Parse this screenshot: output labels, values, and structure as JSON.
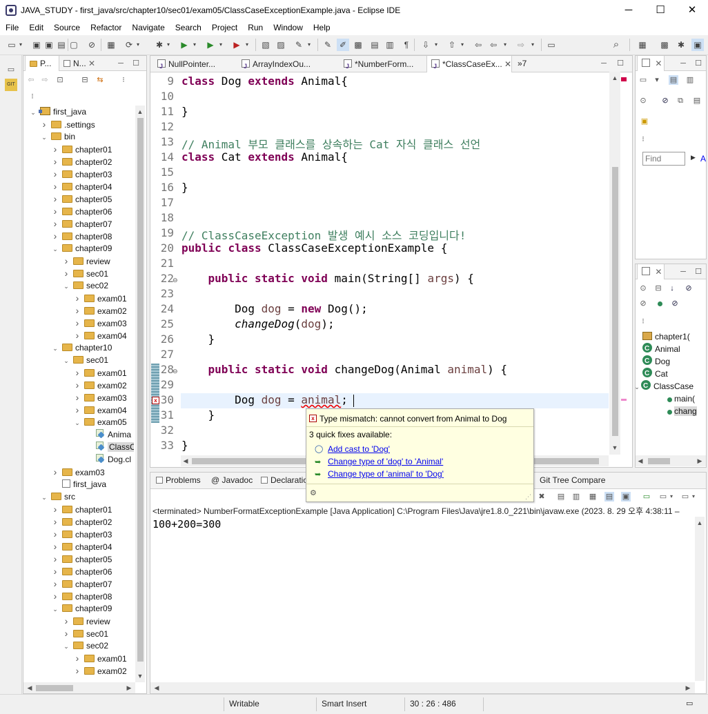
{
  "window": {
    "title": "JAVA_STUDY - first_java/src/chapter10/sec01/exam05/ClassCaseExceptionExample.java - Eclipse IDE",
    "minimize": "─",
    "maximize": "☐",
    "close": "✕"
  },
  "menu": [
    "File",
    "Edit",
    "Source",
    "Refactor",
    "Navigate",
    "Search",
    "Project",
    "Run",
    "Window",
    "Help"
  ],
  "left_panel": {
    "tabs": [
      "P...",
      "N..."
    ],
    "tree": [
      {
        "label": "first_java",
        "depth": 0,
        "twisty": "open",
        "icon": "project"
      },
      {
        "label": ".settings",
        "depth": 1,
        "twisty": "closed",
        "icon": "folder"
      },
      {
        "label": "bin",
        "depth": 1,
        "twisty": "open",
        "icon": "folder"
      },
      {
        "label": "chapter01",
        "depth": 2,
        "twisty": "closed",
        "icon": "folder"
      },
      {
        "label": "chapter02",
        "depth": 2,
        "twisty": "closed",
        "icon": "folder"
      },
      {
        "label": "chapter03",
        "depth": 2,
        "twisty": "closed",
        "icon": "folder"
      },
      {
        "label": "chapter04",
        "depth": 2,
        "twisty": "closed",
        "icon": "folder"
      },
      {
        "label": "chapter05",
        "depth": 2,
        "twisty": "closed",
        "icon": "folder"
      },
      {
        "label": "chapter06",
        "depth": 2,
        "twisty": "closed",
        "icon": "folder"
      },
      {
        "label": "chapter07",
        "depth": 2,
        "twisty": "closed",
        "icon": "folder"
      },
      {
        "label": "chapter08",
        "depth": 2,
        "twisty": "closed",
        "icon": "folder"
      },
      {
        "label": "chapter09",
        "depth": 2,
        "twisty": "open",
        "icon": "folder"
      },
      {
        "label": "review",
        "depth": 3,
        "twisty": "closed",
        "icon": "folder"
      },
      {
        "label": "sec01",
        "depth": 3,
        "twisty": "closed",
        "icon": "folder"
      },
      {
        "label": "sec02",
        "depth": 3,
        "twisty": "open",
        "icon": "folder"
      },
      {
        "label": "exam01",
        "depth": 4,
        "twisty": "closed",
        "icon": "folder"
      },
      {
        "label": "exam02",
        "depth": 4,
        "twisty": "closed",
        "icon": "folder"
      },
      {
        "label": "exam03",
        "depth": 4,
        "twisty": "closed",
        "icon": "folder"
      },
      {
        "label": "exam04",
        "depth": 4,
        "twisty": "closed",
        "icon": "folder"
      },
      {
        "label": "chapter10",
        "depth": 2,
        "twisty": "open",
        "icon": "folder"
      },
      {
        "label": "sec01",
        "depth": 3,
        "twisty": "open",
        "icon": "folder"
      },
      {
        "label": "exam01",
        "depth": 4,
        "twisty": "closed",
        "icon": "folder"
      },
      {
        "label": "exam02",
        "depth": 4,
        "twisty": "closed",
        "icon": "folder"
      },
      {
        "label": "exam03",
        "depth": 4,
        "twisty": "closed",
        "icon": "folder"
      },
      {
        "label": "exam04",
        "depth": 4,
        "twisty": "closed",
        "icon": "folder"
      },
      {
        "label": "exam05",
        "depth": 4,
        "twisty": "open",
        "icon": "folder"
      },
      {
        "label": "Anima",
        "depth": 5,
        "twisty": "none",
        "icon": "class"
      },
      {
        "label": "ClassC",
        "depth": 5,
        "twisty": "none",
        "icon": "class",
        "selected": true
      },
      {
        "label": "Dog.cl",
        "depth": 5,
        "twisty": "none",
        "icon": "class"
      },
      {
        "label": "exam03",
        "depth": 2,
        "twisty": "closed",
        "icon": "folder"
      },
      {
        "label": "first_java",
        "depth": 2,
        "twisty": "none",
        "icon": "file"
      },
      {
        "label": "src",
        "depth": 1,
        "twisty": "open",
        "icon": "folder"
      },
      {
        "label": "chapter01",
        "depth": 2,
        "twisty": "closed",
        "icon": "folder"
      },
      {
        "label": "chapter02",
        "depth": 2,
        "twisty": "closed",
        "icon": "folder"
      },
      {
        "label": "chapter03",
        "depth": 2,
        "twisty": "closed",
        "icon": "folder"
      },
      {
        "label": "chapter04",
        "depth": 2,
        "twisty": "closed",
        "icon": "folder"
      },
      {
        "label": "chapter05",
        "depth": 2,
        "twisty": "closed",
        "icon": "folder"
      },
      {
        "label": "chapter06",
        "depth": 2,
        "twisty": "closed",
        "icon": "folder"
      },
      {
        "label": "chapter07",
        "depth": 2,
        "twisty": "closed",
        "icon": "folder"
      },
      {
        "label": "chapter08",
        "depth": 2,
        "twisty": "closed",
        "icon": "folder"
      },
      {
        "label": "chapter09",
        "depth": 2,
        "twisty": "open",
        "icon": "folder"
      },
      {
        "label": "review",
        "depth": 3,
        "twisty": "closed",
        "icon": "folder"
      },
      {
        "label": "sec01",
        "depth": 3,
        "twisty": "closed",
        "icon": "folder"
      },
      {
        "label": "sec02",
        "depth": 3,
        "twisty": "open",
        "icon": "folder"
      },
      {
        "label": "exam01",
        "depth": 4,
        "twisty": "closed",
        "icon": "folder"
      },
      {
        "label": "exam02",
        "depth": 4,
        "twisty": "closed",
        "icon": "folder"
      }
    ]
  },
  "editor": {
    "tabs": [
      {
        "label": "NullPointer...",
        "active": false
      },
      {
        "label": "ArrayIndexOu...",
        "active": false
      },
      {
        "label": "*NumberForm...",
        "active": false
      },
      {
        "label": "*ClassCaseEx...",
        "active": true
      }
    ],
    "overflow": "»7",
    "lines": [
      {
        "n": "9",
        "html": "<span class='kw'>class</span> Dog <span class='kw'>extends</span> Animal{"
      },
      {
        "n": "10",
        "html": ""
      },
      {
        "n": "11",
        "html": "}"
      },
      {
        "n": "12",
        "html": ""
      },
      {
        "n": "13",
        "html": "<span class='cm'>// Animal 부모 클래스를 상속하는 Cat 자식 클래스 선언</span>"
      },
      {
        "n": "14",
        "html": "<span class='kw'>class</span> Cat <span class='kw'>extends</span> Animal{"
      },
      {
        "n": "15",
        "html": ""
      },
      {
        "n": "16",
        "html": "}"
      },
      {
        "n": "17",
        "html": ""
      },
      {
        "n": "18",
        "html": ""
      },
      {
        "n": "19",
        "html": "<span class='cm'>// ClassCaseException 발생 예시 소스 코딩입니다!</span>"
      },
      {
        "n": "20",
        "html": "<span class='kw'>public</span> <span class='kw'>class</span> ClassCaseExceptionExample {"
      },
      {
        "n": "21",
        "html": ""
      },
      {
        "n": "22",
        "html": "    <span class='kw'>public</span> <span class='kw'>static</span> <span class='kw'>void</span> main(String[] <span class='var'>args</span>) {"
      },
      {
        "n": "23",
        "html": ""
      },
      {
        "n": "24",
        "html": "        Dog <span class='var'>dog</span> = <span class='kw'>new</span> Dog();"
      },
      {
        "n": "25",
        "html": "        <span class='it'>changeDog</span>(<span class='var'>dog</span>);"
      },
      {
        "n": "26",
        "html": "    }"
      },
      {
        "n": "27",
        "html": ""
      },
      {
        "n": "28",
        "html": "    <span class='kw'>public</span> <span class='kw'>static</span> <span class='kw'>void</span> changeDog(Animal <span class='var'>animal</span>) {"
      },
      {
        "n": "29",
        "html": ""
      },
      {
        "n": "30",
        "html": "        Dog <span class='var'>dog</span> = <span class='var' style='text-decoration:underline wavy #e00'>animal</span>;"
      },
      {
        "n": "31",
        "html": "    }"
      },
      {
        "n": "32",
        "html": ""
      },
      {
        "n": "33",
        "html": "}"
      }
    ]
  },
  "popup": {
    "message": "Type mismatch: cannot convert from Animal to Dog",
    "subtitle": "3 quick fixes available:",
    "fixes": [
      "Add cast to 'Dog'",
      "Change type of 'dog' to 'Animal'",
      "Change type of 'animal' to 'Dog'"
    ]
  },
  "bottom_panel": {
    "tabs": [
      "Problems",
      "@ Javadoc",
      "Declaratio"
    ],
    "extra_tab": "Git Tree Compare",
    "console_header": "<terminated> NumberFormatExceptionExample [Java Application] C:\\Program Files\\Java\\jre1.8.0_221\\bin\\javaw.exe  (2023. 8. 29 오후 4:38:11 –",
    "console_output": "100+200=300"
  },
  "right_panel": {
    "find_placeholder": "Find",
    "find_action": "A",
    "outline": [
      {
        "label": "chapter1(",
        "icon": "pkg",
        "depth": 0
      },
      {
        "label": "Animal",
        "icon": "c",
        "depth": 0
      },
      {
        "label": "Dog",
        "icon": "c",
        "depth": 0
      },
      {
        "label": "Cat",
        "icon": "c",
        "depth": 0
      },
      {
        "label": "ClassCase",
        "icon": "c",
        "depth": 0,
        "open": true
      },
      {
        "label": "main(",
        "icon": "meth",
        "depth": 1
      },
      {
        "label": "chang",
        "icon": "meth",
        "depth": 1,
        "selected": true
      }
    ]
  },
  "status": {
    "writable": "Writable",
    "insert": "Smart Insert",
    "position": "30 : 26 : 486"
  }
}
